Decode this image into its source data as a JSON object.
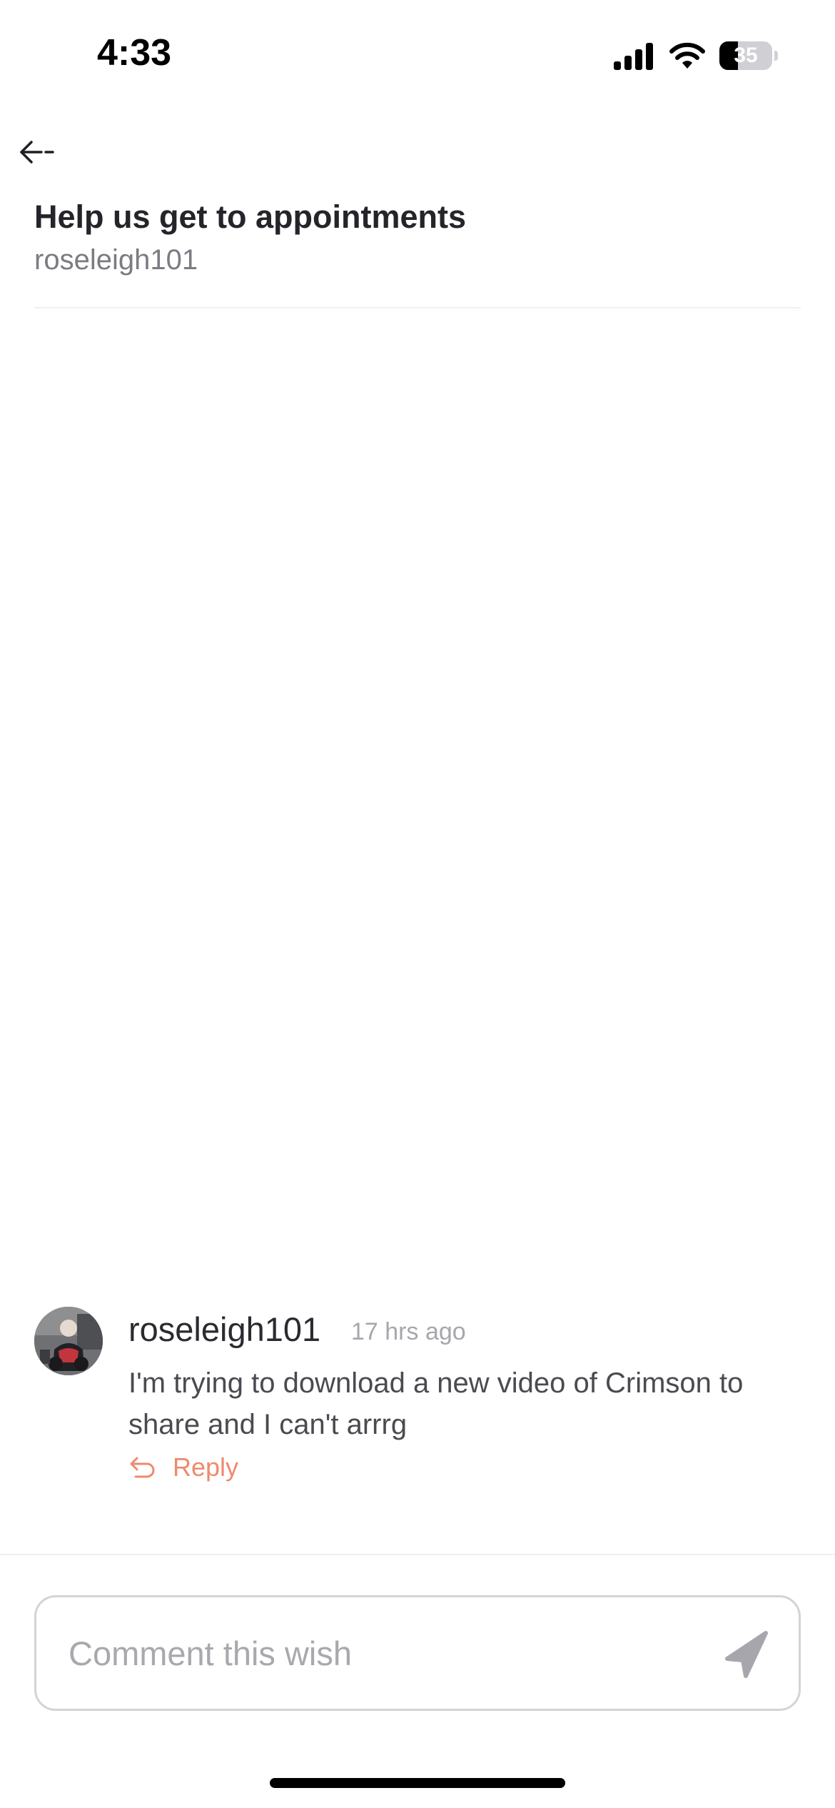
{
  "status_bar": {
    "time": "4:33",
    "battery_level": "35",
    "battery_fraction": 0.35,
    "icons": [
      "signal-icon",
      "wifi-icon",
      "battery-icon"
    ]
  },
  "header": {
    "back_icon": "back-arrow-icon",
    "title": "Help us get to appointments",
    "subtitle": "roseleigh101"
  },
  "comments": [
    {
      "author": "roseleigh101",
      "time": "17 hrs ago",
      "text": "I'm trying to download a new video of Crimson to share and I can't arrrg",
      "reply_label": "Reply",
      "reply_icon": "reply-arrow-icon"
    }
  ],
  "composer": {
    "placeholder": "Comment this wish",
    "send_icon": "send-icon"
  },
  "colors": {
    "accent": "#ee8a6e",
    "title": "#24242a",
    "muted": "#7b7b83"
  }
}
